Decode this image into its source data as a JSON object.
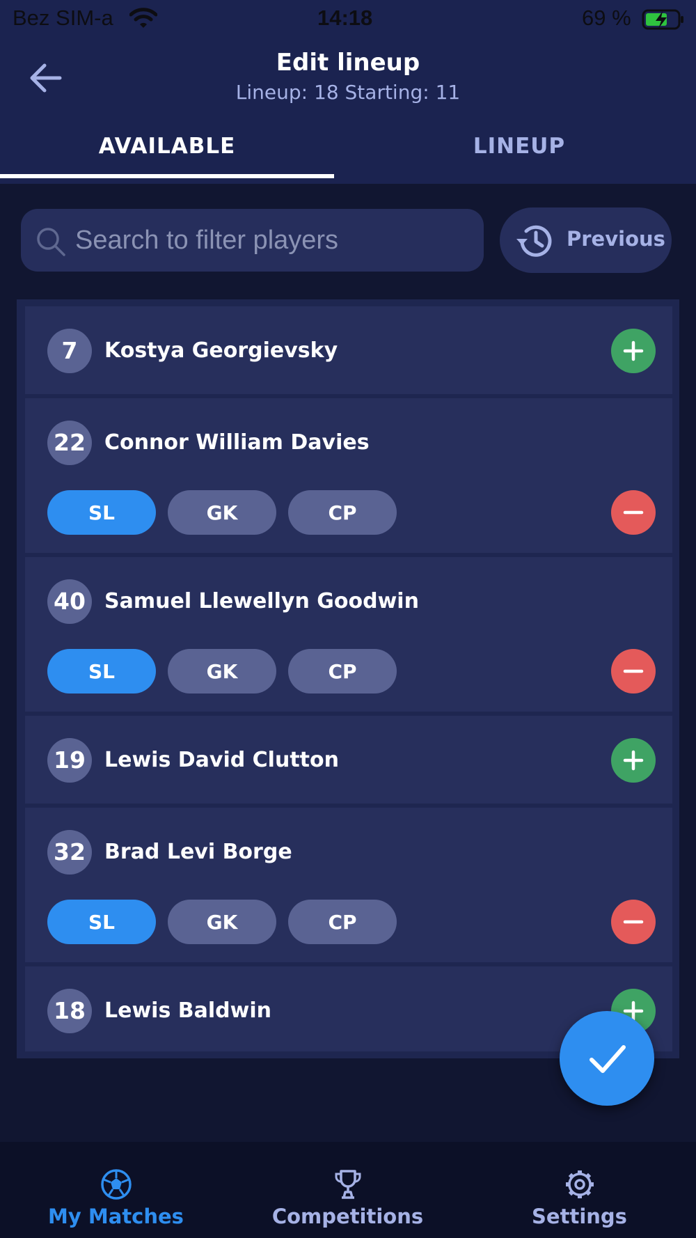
{
  "status_bar": {
    "carrier": "Bez SIM-a",
    "time": "14:18",
    "battery": "69 %"
  },
  "header": {
    "title": "Edit lineup",
    "subtitle": "Lineup: 18 Starting: 11",
    "back_icon": "arrow-left-icon"
  },
  "tabs": [
    {
      "label": "AVAILABLE",
      "active": true
    },
    {
      "label": "LINEUP",
      "active": false
    }
  ],
  "search": {
    "placeholder": "Search to filter players",
    "value": ""
  },
  "previous_button": {
    "label": "Previous",
    "icon": "history-icon"
  },
  "players": [
    {
      "number": "7",
      "name": "Kostya Georgievsky",
      "action": "add"
    },
    {
      "number": "22",
      "name": "Connor William Davies",
      "action": "remove",
      "roles": [
        {
          "label": "SL",
          "selected": true
        },
        {
          "label": "GK",
          "selected": false
        },
        {
          "label": "CP",
          "selected": false
        }
      ]
    },
    {
      "number": "40",
      "name": "Samuel Llewellyn Goodwin",
      "action": "remove",
      "roles": [
        {
          "label": "SL",
          "selected": true
        },
        {
          "label": "GK",
          "selected": false
        },
        {
          "label": "CP",
          "selected": false
        }
      ]
    },
    {
      "number": "19",
      "name": "Lewis David Clutton",
      "action": "add"
    },
    {
      "number": "32",
      "name": "Brad Levi Borge",
      "action": "remove",
      "roles": [
        {
          "label": "SL",
          "selected": true
        },
        {
          "label": "GK",
          "selected": false
        },
        {
          "label": "CP",
          "selected": false
        }
      ]
    },
    {
      "number": "18",
      "name": "Lewis Baldwin",
      "action": "add"
    }
  ],
  "confirm_icon": "checkmark-icon",
  "bottom_nav": [
    {
      "label": "My Matches",
      "icon": "soccer-ball-icon",
      "active": true
    },
    {
      "label": "Competitions",
      "icon": "trophy-icon",
      "active": false
    },
    {
      "label": "Settings",
      "icon": "gear-icon",
      "active": false
    }
  ],
  "colors": {
    "background": "#111631",
    "header": "#1b2350",
    "row": "#272f5c",
    "accent_blue": "#2e8ef0",
    "add_green": "#3fa364",
    "remove_red": "#e45a5a",
    "muted_text": "#a6b2e6"
  }
}
